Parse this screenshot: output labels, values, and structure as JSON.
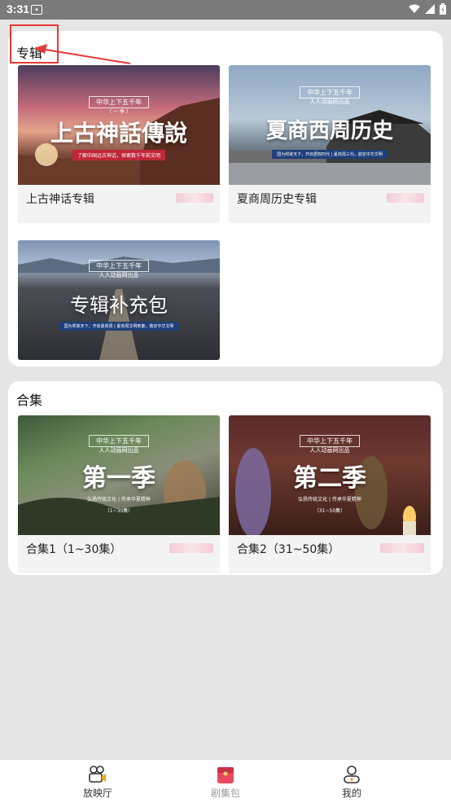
{
  "status_bar": {
    "time": "3:31"
  },
  "albums": {
    "title": "专辑",
    "items": [
      {
        "label": "上古神话专辑",
        "poster_top": "中华上下五千年",
        "poster_sub": "（ 一 季 ）",
        "poster_title": "上古神話傳說",
        "poster_banner": "了解中国远古神话，探索数千年前文明"
      },
      {
        "label": "夏商周历史专辑",
        "poster_top": "中华上下五千年",
        "poster_sub": "人人动画网出品",
        "poster_title": "夏商西周历史",
        "poster_banner": "国为邦家天下，开启君权时代 | 夏商周三代，鼎定中华文明"
      },
      {
        "label": "",
        "poster_top": "中华上下五千年",
        "poster_sub": "人人动画网出品",
        "poster_title": "专辑补充包",
        "poster_banner": "国为邦家天下，开启夏商周 | 夏商周文明到秦，鼎定中华文明"
      }
    ]
  },
  "collections": {
    "title": "合集",
    "items": [
      {
        "label": "合集1（1~30集）",
        "poster_top": "中华上下五千年",
        "poster_sub": "人人动画网出品",
        "poster_title": "第一季",
        "poster_banner": "弘扬传统文化 | 传承华夏精神",
        "poster_eps": "（1~30集）"
      },
      {
        "label": "合集2（31~50集）",
        "poster_top": "中华上下五千年",
        "poster_sub": "人人动画网出品",
        "poster_title": "第二季",
        "poster_banner": "弘扬传统文化 | 传承华夏精神",
        "poster_eps": "（31~50集）"
      }
    ]
  },
  "bottom_nav": [
    {
      "label": "放映厅",
      "icon": "camera-icon",
      "active": false
    },
    {
      "label": "剧集包",
      "icon": "gift-icon",
      "active": true
    },
    {
      "label": "我的",
      "icon": "user-icon",
      "active": false
    }
  ],
  "colors": {
    "annotation": "#e53935",
    "active_tab_text": "#999999",
    "gift_icon": "#e84a5f"
  }
}
